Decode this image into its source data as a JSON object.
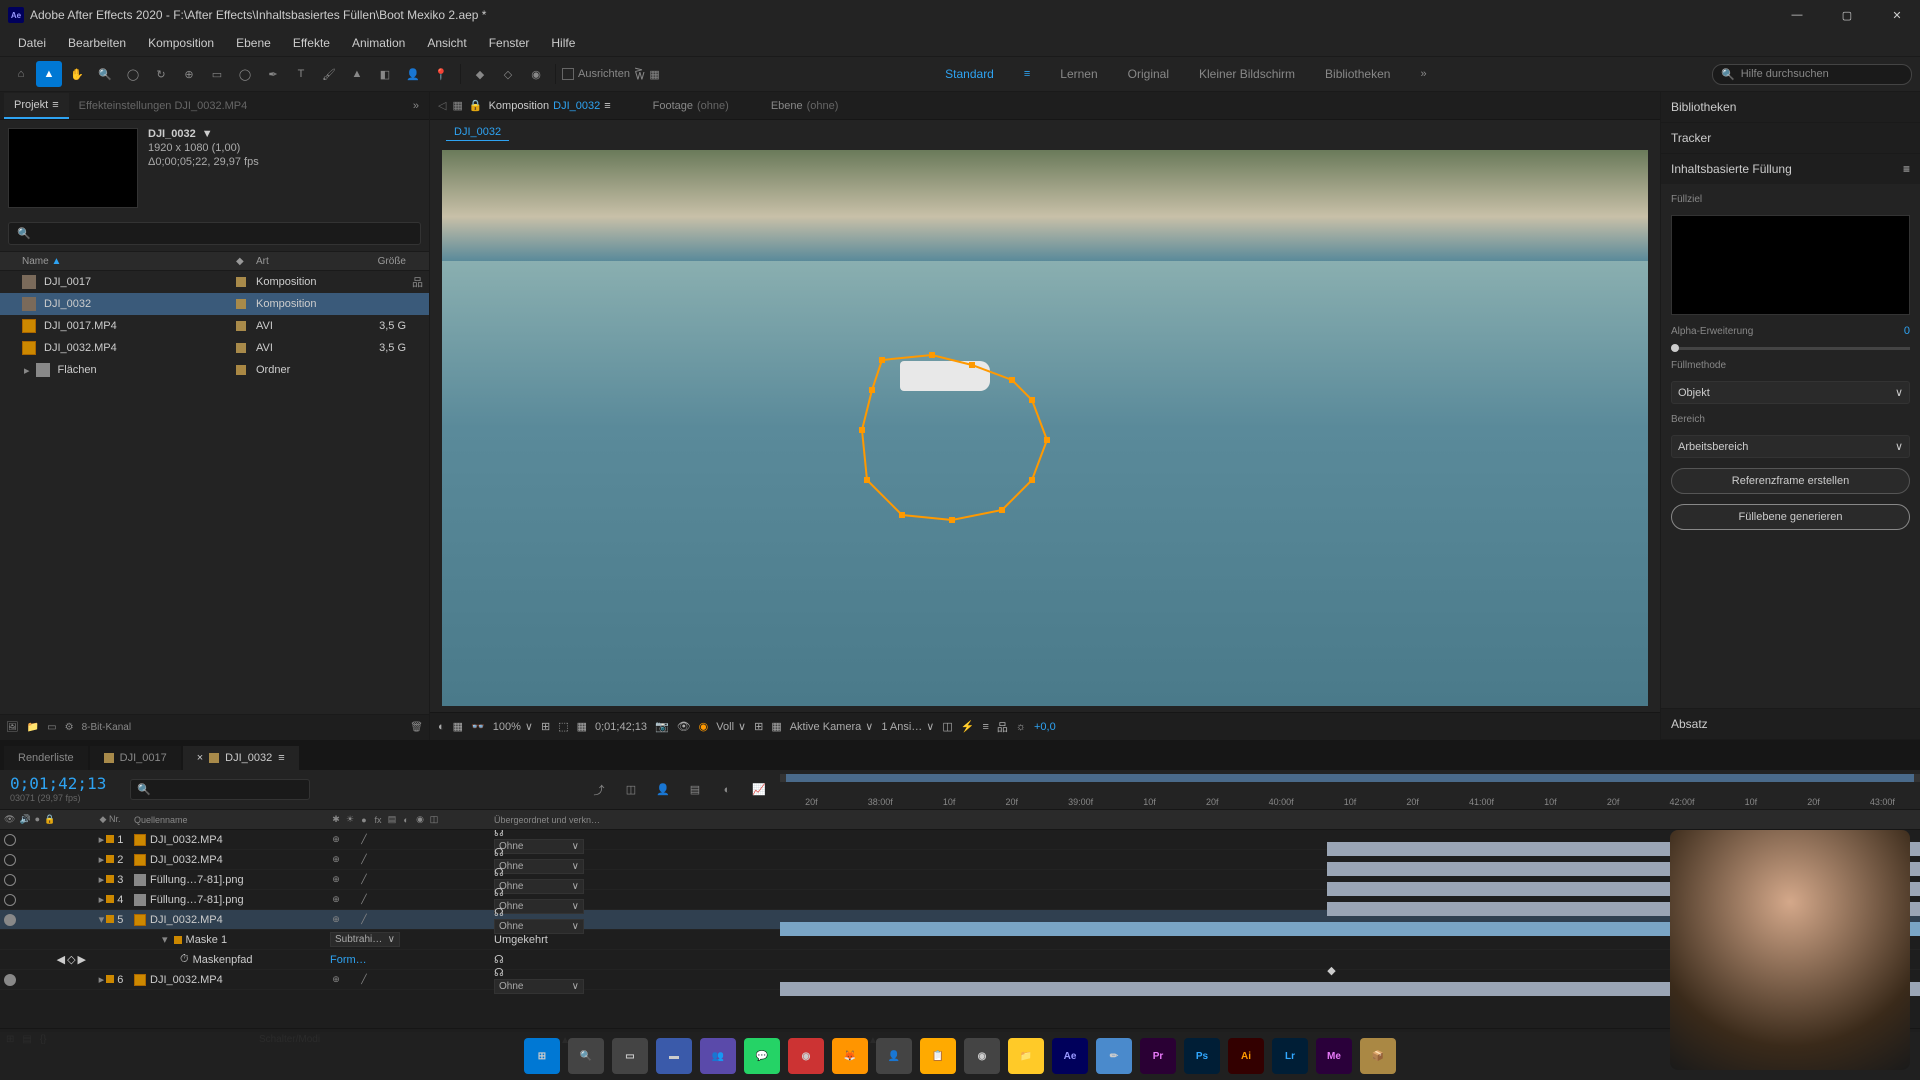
{
  "titlebar": {
    "app_icon": "Ae",
    "title": "Adobe After Effects 2020 - F:\\After Effects\\Inhaltsbasiertes Füllen\\Boot Mexiko 2.aep *"
  },
  "menu": {
    "items": [
      "Datei",
      "Bearbeiten",
      "Komposition",
      "Ebene",
      "Effekte",
      "Animation",
      "Ansicht",
      "Fenster",
      "Hilfe"
    ]
  },
  "toolbar": {
    "snap_label": "Ausrichten",
    "workspaces": [
      "Standard",
      "Lernen",
      "Original",
      "Kleiner Bildschirm",
      "Bibliotheken"
    ],
    "active_workspace": "Standard",
    "search_placeholder": "Hilfe durchsuchen"
  },
  "project": {
    "tab_projekt": "Projekt",
    "tab_effekt": "Effekteinstellungen DJI_0032.MP4",
    "selected_name": "DJI_0032",
    "meta_res": "1920 x 1080 (1,00)",
    "meta_dur": "Δ0;00;05;22, 29,97 fps",
    "cols": {
      "name": "Name",
      "art": "Art",
      "size": "Größe"
    },
    "items": [
      {
        "name": "DJI_0017",
        "type": "Komposition",
        "size": "",
        "icon": "comp"
      },
      {
        "name": "DJI_0032",
        "type": "Komposition",
        "size": "",
        "icon": "comp",
        "selected": true
      },
      {
        "name": "DJI_0017.MP4",
        "type": "AVI",
        "size": "3,5 G",
        "icon": "mov"
      },
      {
        "name": "DJI_0032.MP4",
        "type": "AVI",
        "size": "3,5 G",
        "icon": "mov"
      },
      {
        "name": "Flächen",
        "type": "Ordner",
        "size": "",
        "icon": "folder"
      }
    ],
    "footer_depth": "8-Bit-Kanal"
  },
  "comp": {
    "tab_label": "Komposition",
    "active_comp": "DJI_0032",
    "footage_tab": "Footage",
    "footage_none": "(ohne)",
    "layer_tab": "Ebene",
    "layer_none": "(ohne)",
    "breadcrumb": "DJI_0032"
  },
  "viewer_footer": {
    "zoom": "100%",
    "timecode": "0;01;42;13",
    "res": "Voll",
    "camera": "Aktive Kamera",
    "views": "1 Ansi…",
    "exposure": "+0,0"
  },
  "right": {
    "lib_label": "Bibliotheken",
    "tracker_label": "Tracker",
    "fill_label": "Inhaltsbasierte Füllung",
    "target_label": "Füllziel",
    "alpha_label": "Alpha-Erweiterung",
    "alpha_value": "0",
    "method_label": "Füllmethode",
    "method_value": "Objekt",
    "range_label": "Bereich",
    "range_value": "Arbeitsbereich",
    "ref_btn": "Referenzframe erstellen",
    "gen_btn": "Füllebene generieren",
    "absatz_label": "Absatz"
  },
  "timeline": {
    "tabs": {
      "render": "Renderliste",
      "t1": "DJI_0017",
      "t2": "DJI_0032"
    },
    "timecode": "0;01;42;13",
    "frames": "03071 (29,97 fps)",
    "cols": {
      "nr": "Nr.",
      "src": "Quellenname",
      "parent": "Übergeordnet und verkn…"
    },
    "ticks": [
      "20f",
      "38:00f",
      "10f",
      "20f",
      "39:00f",
      "10f",
      "20f",
      "40:00f",
      "10f",
      "20f",
      "41:00f",
      "10f",
      "20f",
      "42:00f",
      "10f",
      "20f",
      "43:00f"
    ],
    "parent_none": "Ohne",
    "layers": [
      {
        "nr": "1",
        "name": "DJI_0032.MP4",
        "icon": "mov",
        "eye": false,
        "bar": "half"
      },
      {
        "nr": "2",
        "name": "DJI_0032.MP4",
        "icon": "mov",
        "eye": false,
        "bar": "half"
      },
      {
        "nr": "3",
        "name": "Füllung…7-81].png",
        "icon": "img",
        "eye": false,
        "bar": "half"
      },
      {
        "nr": "4",
        "name": "Füllung…7-81].png",
        "icon": "img",
        "eye": false,
        "bar": "half"
      },
      {
        "nr": "5",
        "name": "DJI_0032.MP4",
        "icon": "mov",
        "eye": true,
        "bar": "full",
        "selected": true
      }
    ],
    "mask": {
      "name": "Maske 1",
      "mode": "Subtrahi…",
      "invert": "Umgekehrt",
      "path_label": "Maskenpfad",
      "path_val": "Form…"
    },
    "layer6": {
      "nr": "6",
      "name": "DJI_0032.MP4"
    },
    "footer_label": "Schalter/Modi"
  }
}
